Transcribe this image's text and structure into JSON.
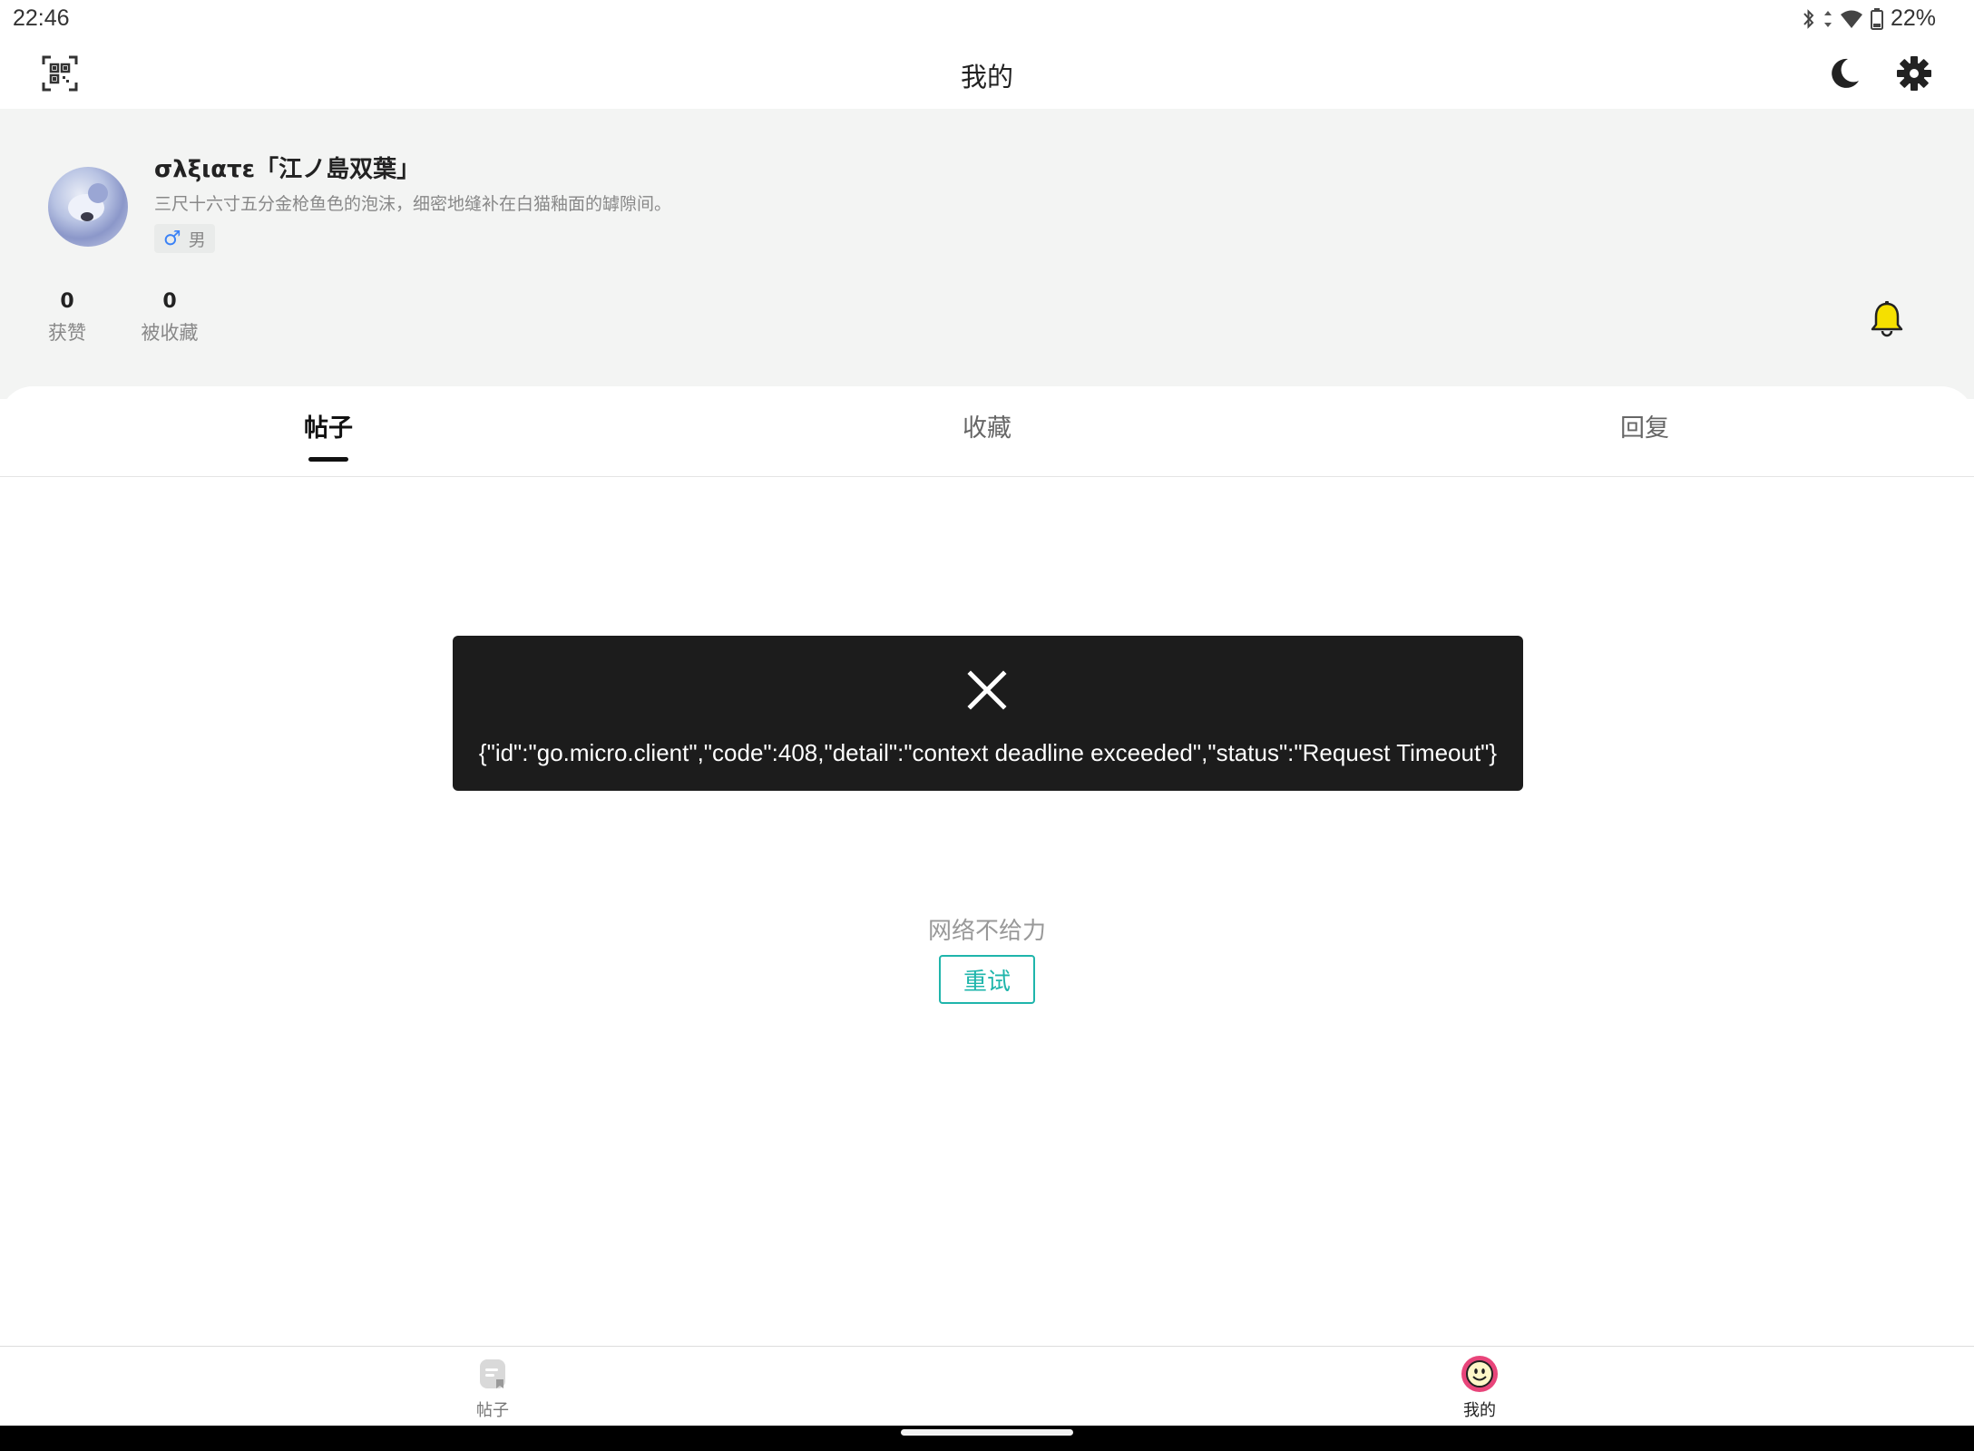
{
  "status_bar": {
    "time": "22:46",
    "battery_percent": "22%",
    "icons": [
      "bluetooth-icon",
      "data-arrows-icon",
      "wifi-icon",
      "battery-icon"
    ]
  },
  "header": {
    "title": "我的",
    "left_icon": "qr-scan-icon",
    "right_icons": [
      "moon-icon",
      "gear-icon"
    ]
  },
  "profile": {
    "username": "σλξιατε「江ノ島双葉」",
    "bio": "三尺十六寸五分金枪鱼色的泡沫，细密地缝补在白猫釉面的罅隙间。",
    "gender_symbol": "♂",
    "gender_label": "男",
    "stats": [
      {
        "value": "0",
        "label": "获赞"
      },
      {
        "value": "0",
        "label": "被收藏"
      }
    ],
    "bell_color": "#f5e000"
  },
  "tabs": [
    {
      "label": "帖子",
      "active": true
    },
    {
      "label": "收藏",
      "active": false
    },
    {
      "label": "回复",
      "active": false
    }
  ],
  "toast": {
    "message": "{\"id\":\"go.micro.client\",\"code\":408,\"detail\":\"context deadline exceeded\",\"status\":\"Request Timeout\"}"
  },
  "empty_state": {
    "text": "网络不给力",
    "retry_label": "重试"
  },
  "bottom_nav": [
    {
      "label": "帖子",
      "icon": "posts-icon",
      "active": false
    },
    {
      "label": "我的",
      "icon": "smiley-icon",
      "active": true
    }
  ],
  "colors": {
    "accent": "#1fb5ab",
    "profile_bg": "#f3f4f3",
    "toast_bg": "#1c1c1c",
    "smiley_ring": "#e8457a"
  }
}
